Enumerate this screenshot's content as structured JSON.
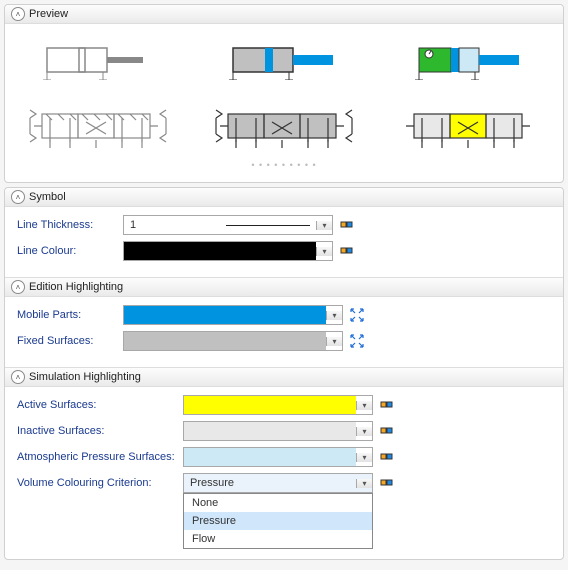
{
  "panels": {
    "preview": {
      "title": "Preview"
    },
    "symbol": {
      "title": "Symbol",
      "line_thickness_label": "Line Thickness:",
      "line_thickness_value": "1",
      "line_colour_label": "Line Colour:",
      "line_colour_value": "#000000"
    },
    "edition": {
      "title": "Edition Highlighting",
      "mobile_parts_label": "Mobile Parts:",
      "mobile_parts_value": "#0094e0",
      "fixed_surfaces_label": "Fixed Surfaces:",
      "fixed_surfaces_value": "#c0c0c0"
    },
    "simulation": {
      "title": "Simulation Highlighting",
      "active_label": "Active Surfaces:",
      "active_value": "#ffff00",
      "inactive_label": "Inactive Surfaces:",
      "inactive_value": "#e8e8e8",
      "atmos_label": "Atmospheric Pressure Surfaces:",
      "atmos_value": "#cce9f5",
      "criterion_label": "Volume Colouring Criterion:",
      "criterion_value": "Pressure",
      "criterion_options": {
        "none": "None",
        "pressure": "Pressure",
        "flow": "Flow"
      }
    }
  }
}
